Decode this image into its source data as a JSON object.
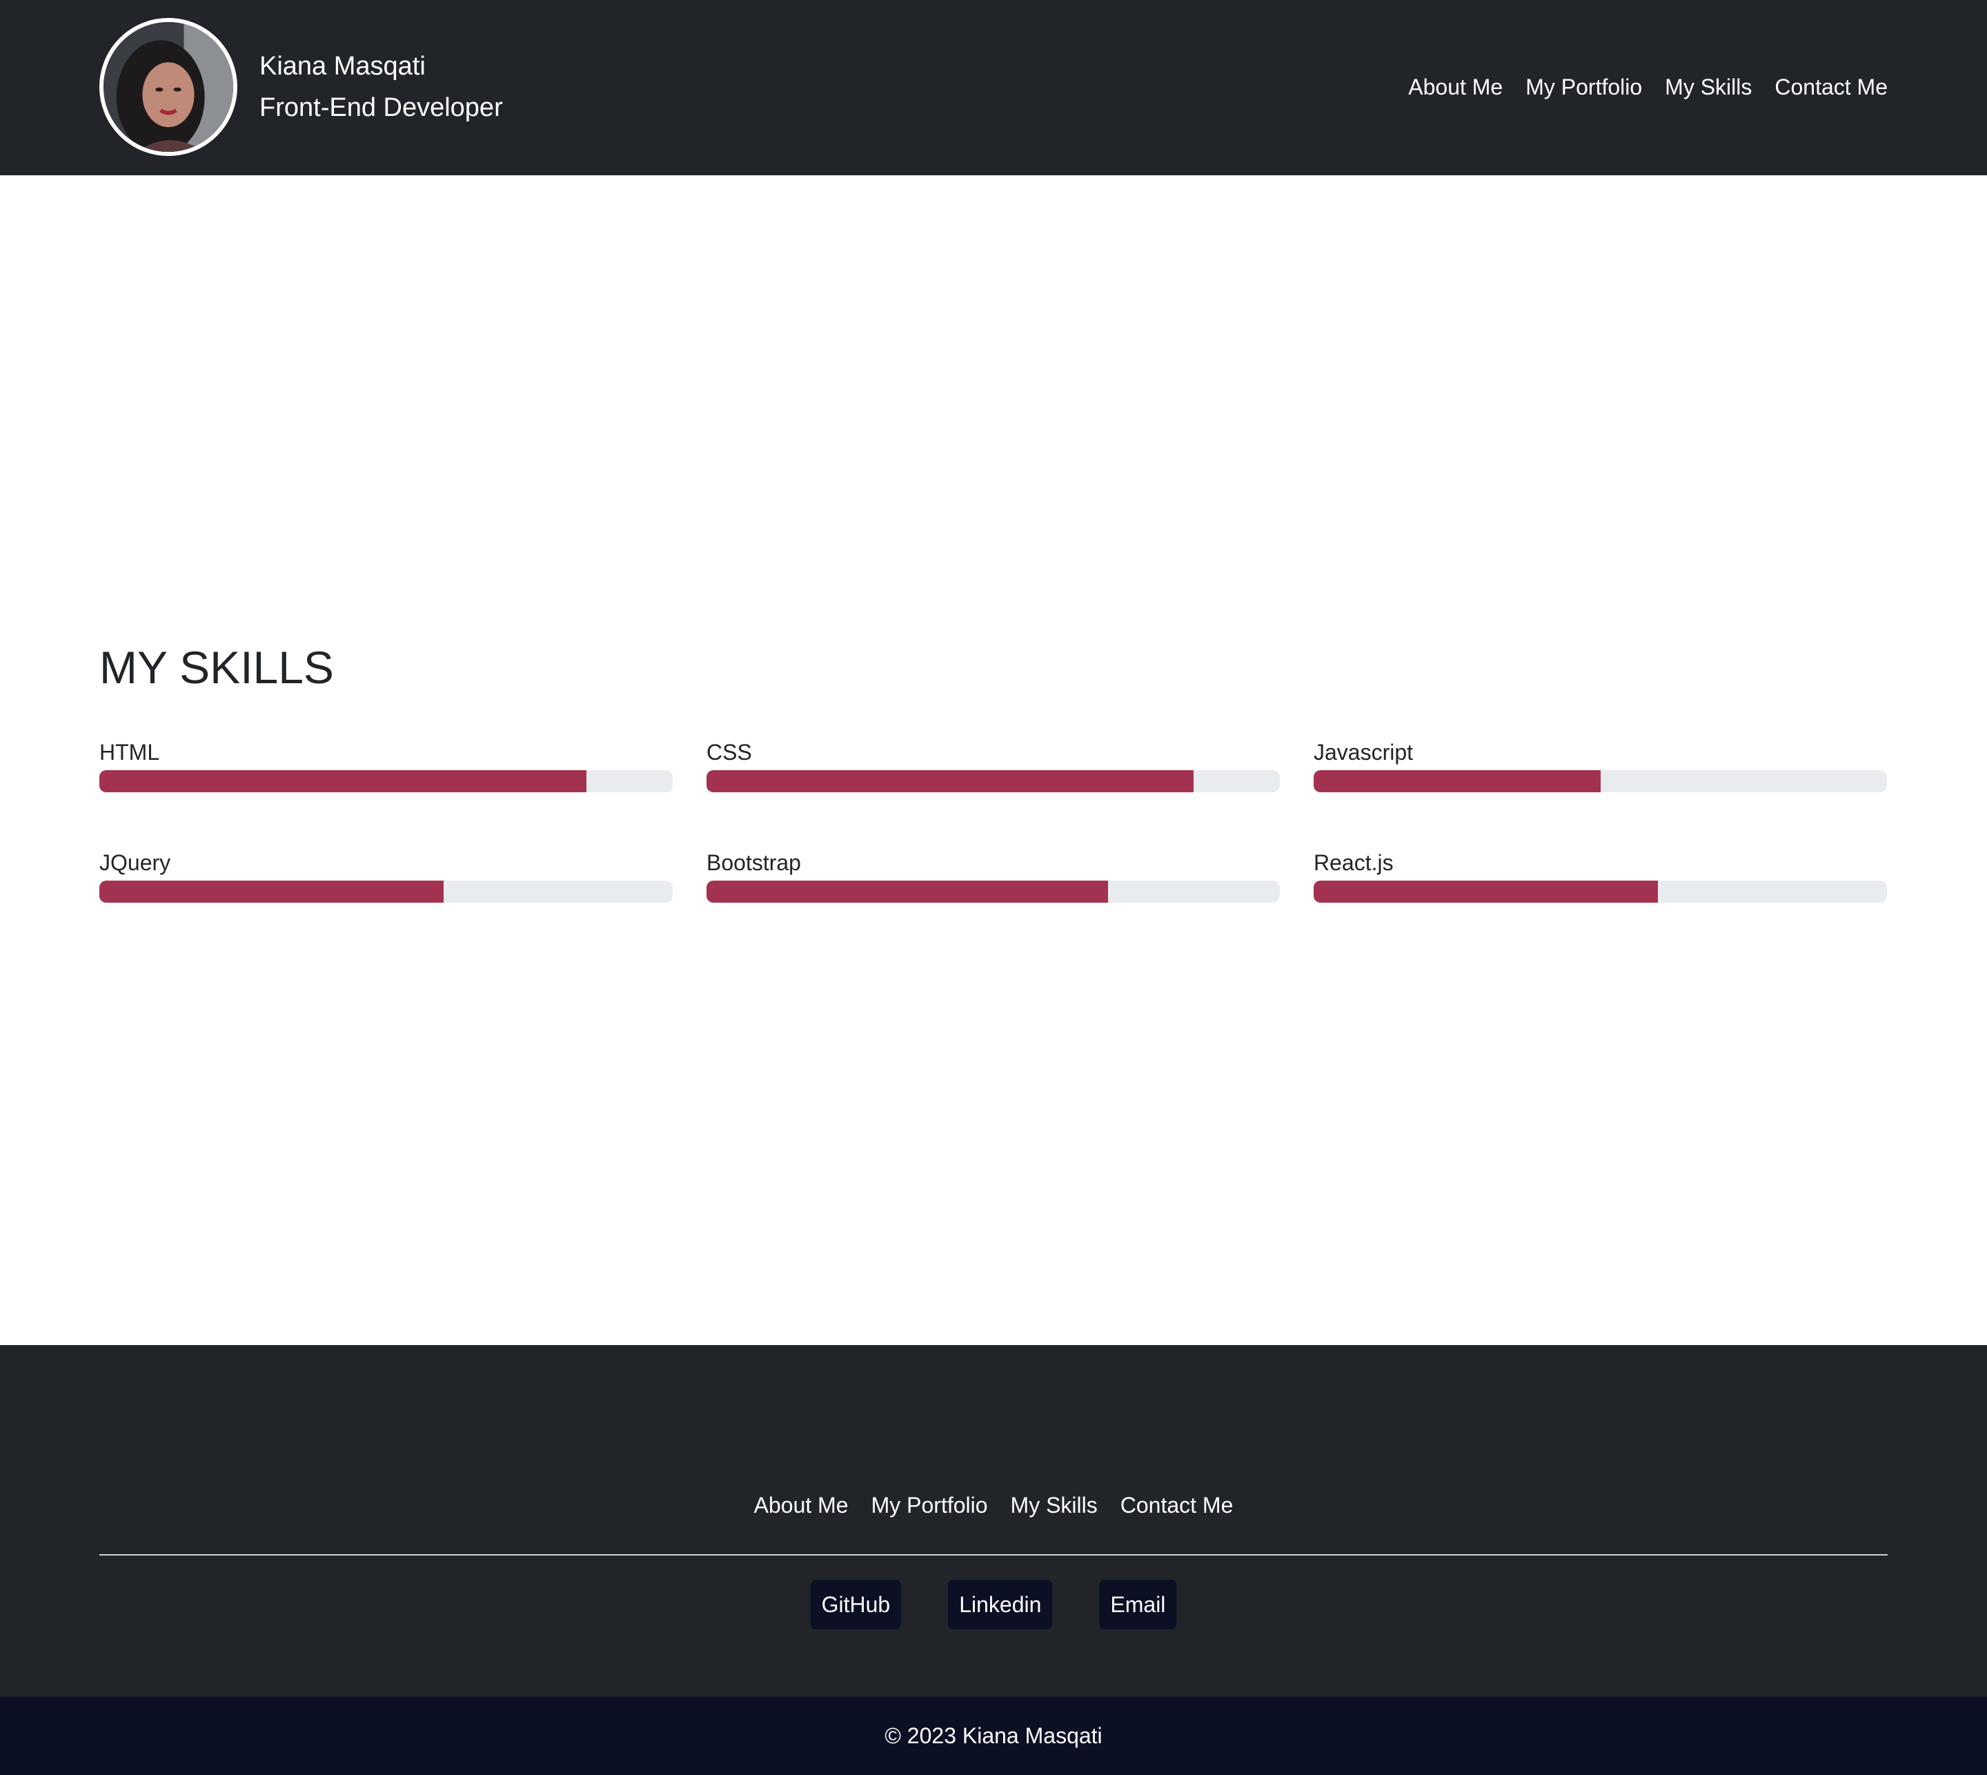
{
  "header": {
    "name": "Kiana Masqati",
    "title": "Front-End Developer",
    "nav": [
      "About Me",
      "My Portfolio",
      "My Skills",
      "Contact Me"
    ]
  },
  "skills": {
    "heading": "MY SKILLS",
    "items": [
      {
        "label": "HTML",
        "level": 0.85
      },
      {
        "label": "CSS",
        "level": 0.85
      },
      {
        "label": "Javascript",
        "level": 0.5
      },
      {
        "label": "JQuery",
        "level": 0.6
      },
      {
        "label": "Bootstrap",
        "level": 0.7
      },
      {
        "label": "React.js",
        "level": 0.6
      }
    ]
  },
  "footer": {
    "nav": [
      "About Me",
      "My Portfolio",
      "My Skills",
      "Contact Me"
    ],
    "social": [
      "GitHub",
      "Linkedin",
      "Email"
    ],
    "copyright": "© 2023 Kiana Masqati"
  },
  "colors": {
    "header_bg": "#212529",
    "progress_fill": "#a33250",
    "progress_track": "#e9ecef",
    "button_bg": "#0c1024"
  },
  "icons": {
    "avatar": "profile-photo"
  }
}
